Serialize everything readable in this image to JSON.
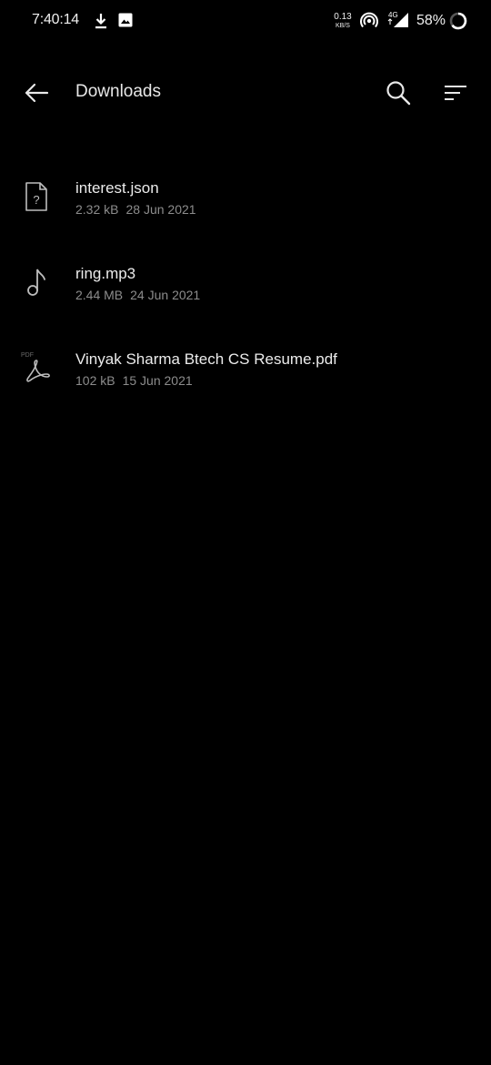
{
  "status_bar": {
    "time": "7:40:14",
    "net_speed_value": "0.13",
    "net_speed_unit": "KB/S",
    "network_type": "4G",
    "battery_percent": "58%",
    "icons": [
      "download-icon",
      "image-icon",
      "hotspot-icon",
      "signal-icon",
      "battery-ring-icon"
    ]
  },
  "toolbar": {
    "title": "Downloads",
    "icons": [
      "back-arrow-icon",
      "search-icon",
      "sort-icon"
    ]
  },
  "files": [
    {
      "name": "interest.json",
      "size": "2.32 kB",
      "date": "28 Jun 2021",
      "icon": "unknown-file-icon"
    },
    {
      "name": "ring.mp3",
      "size": "2.44 MB",
      "date": "24 Jun 2021",
      "icon": "music-note-icon"
    },
    {
      "name": "Vinyak Sharma Btech CS Resume.pdf",
      "size": "102 kB",
      "date": "15 Jun 2021",
      "icon": "pdf-icon",
      "icon_label": "PDF"
    }
  ],
  "colors": {
    "background": "#000000",
    "primary_text": "#ececec",
    "secondary_text": "#8c8c8c"
  }
}
